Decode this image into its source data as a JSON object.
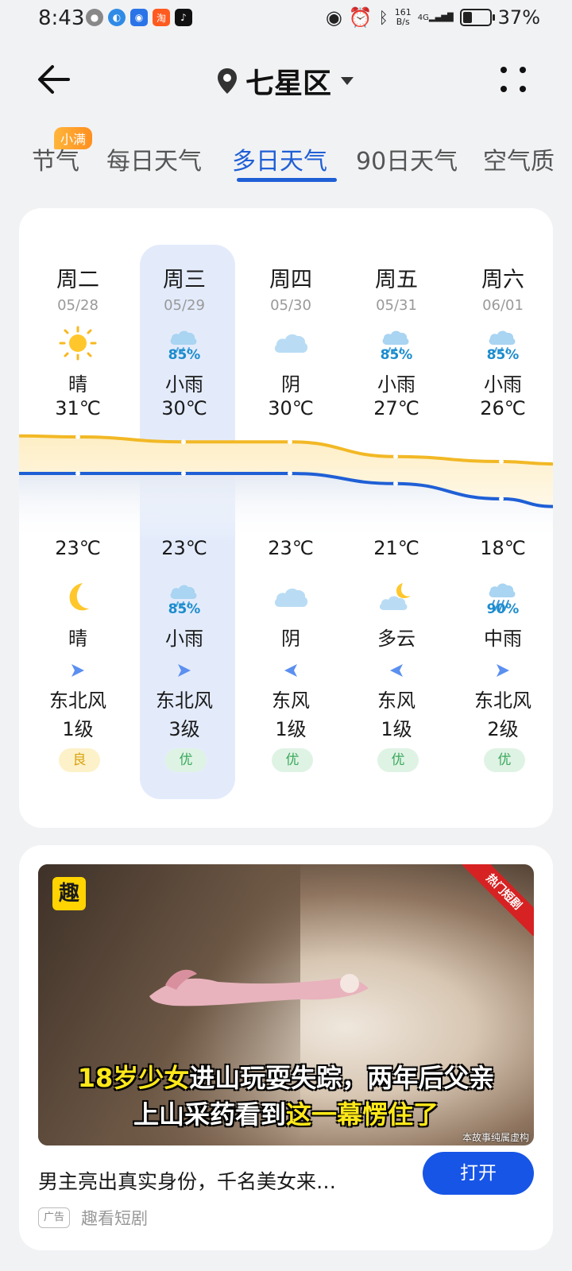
{
  "status_bar": {
    "time": "8:43",
    "net_speed_value": "161",
    "net_speed_unit": "B/s",
    "signal": "4G",
    "battery": "37%",
    "battery_level": 0.37,
    "app_icons": [
      "wechat-icon",
      "browser-icon",
      "assistant-icon",
      "taobao-icon",
      "tiktok-icon"
    ]
  },
  "header": {
    "location": "七星区"
  },
  "tabs": [
    {
      "label": "节气",
      "badge": "小满"
    },
    {
      "label": "每日天气"
    },
    {
      "label": "多日天气",
      "active": true
    },
    {
      "label": "90日天气"
    },
    {
      "label": "空气质"
    }
  ],
  "forecast": {
    "days": [
      {
        "day": "周二",
        "date": "05/28",
        "day_icon": "sun-icon",
        "day_precip": "",
        "day_cond": "晴",
        "high": "31℃",
        "low": "23℃",
        "night_icon": "moon-icon",
        "night_precip": "",
        "night_cond": "晴",
        "wind_dir": "东北风",
        "wind_level": "1级",
        "wind_icon": "arrow-right-icon",
        "aqi": "良",
        "aqi_class": "good"
      },
      {
        "day": "周三",
        "date": "05/29",
        "day_icon": "light-rain-icon",
        "day_precip": "85%",
        "day_cond": "小雨",
        "high": "30℃",
        "low": "23℃",
        "night_icon": "light-rain-icon",
        "night_precip": "85%",
        "night_cond": "小雨",
        "wind_dir": "东北风",
        "wind_level": "3级",
        "wind_icon": "arrow-right-icon",
        "aqi": "优",
        "aqi_class": "excellent"
      },
      {
        "day": "周四",
        "date": "05/30",
        "day_icon": "overcast-icon",
        "day_precip": "",
        "day_cond": "阴",
        "high": "30℃",
        "low": "23℃",
        "night_icon": "overcast-icon",
        "night_precip": "",
        "night_cond": "阴",
        "wind_dir": "东风",
        "wind_level": "1级",
        "wind_icon": "arrow-left-icon",
        "aqi": "优",
        "aqi_class": "excellent"
      },
      {
        "day": "周五",
        "date": "05/31",
        "day_icon": "light-rain-icon",
        "day_precip": "85%",
        "day_cond": "小雨",
        "high": "27℃",
        "low": "21℃",
        "night_icon": "partly-cloudy-night-icon",
        "night_precip": "",
        "night_cond": "多云",
        "wind_dir": "东风",
        "wind_level": "1级",
        "wind_icon": "arrow-left-icon",
        "aqi": "优",
        "aqi_class": "excellent"
      },
      {
        "day": "周六",
        "date": "06/01",
        "day_icon": "light-rain-icon",
        "day_precip": "85%",
        "day_cond": "小雨",
        "high": "26℃",
        "low": "18℃",
        "night_icon": "moderate-rain-icon",
        "night_precip": "90%",
        "night_cond": "中雨",
        "wind_dir": "东北风",
        "wind_level": "2级",
        "wind_icon": "arrow-right-icon",
        "aqi": "优",
        "aqi_class": "excellent"
      }
    ],
    "highs": [
      31,
      30,
      30,
      27,
      26
    ],
    "lows": [
      23,
      23,
      23,
      21,
      18
    ],
    "colors": {
      "high_line": "#f2b825",
      "low_line": "#1f5fd6",
      "highlight": "#e3ebfb"
    }
  },
  "ad": {
    "badge": "趣",
    "hot_label": "热门短剧",
    "caption_line1_a": "18岁少女",
    "caption_line1_b": "进山玩耍失踪，两年后父亲",
    "caption_line2_a": "上山采药看到",
    "caption_line2_b": "这一幕愣住了",
    "disclaimer": "本故事纯属虚构",
    "title": "男主亮出真实身份，千名美女来…",
    "tag": "广告",
    "source": "趣看短剧",
    "button": "打开"
  }
}
